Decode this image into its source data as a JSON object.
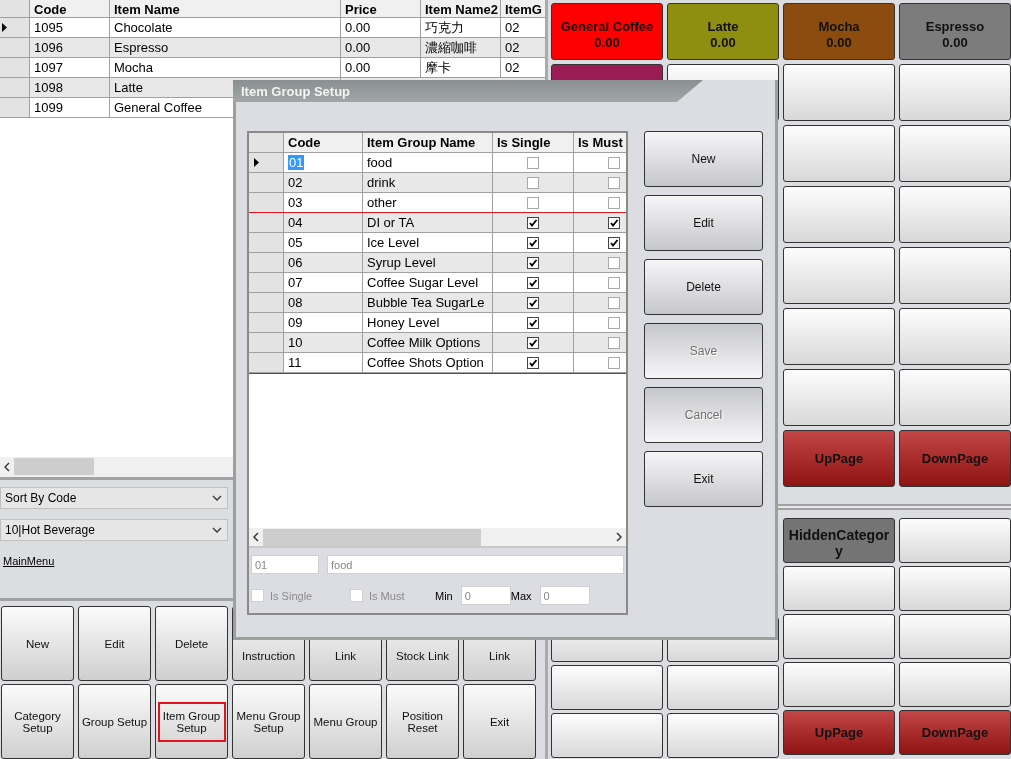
{
  "item_table": {
    "columns": [
      "Code",
      "Item Name",
      "Price",
      "Item Name2",
      "ItemG"
    ],
    "rows": [
      {
        "code": "1095",
        "name": "Chocolate",
        "price": "0.00",
        "name2": "巧克力",
        "group": "02",
        "selected": true
      },
      {
        "code": "1096",
        "name": "Espresso",
        "price": "0.00",
        "name2": "濃縮咖啡",
        "group": "02",
        "selected": false
      },
      {
        "code": "1097",
        "name": "Mocha",
        "price": "0.00",
        "name2": "摩卡",
        "group": "02",
        "selected": false
      },
      {
        "code": "1098",
        "name": "Latte",
        "selected": false
      },
      {
        "code": "1099",
        "name": "General Coffee",
        "selected": false
      }
    ]
  },
  "sort_dropdown": {
    "value": "Sort By Code"
  },
  "category_dropdown": {
    "value": "10|Hot Beverage"
  },
  "main_menu_link": "MainMenu",
  "actions": [
    {
      "label": "New",
      "highlighted": false
    },
    {
      "label": "Edit",
      "highlighted": false
    },
    {
      "label": "Delete",
      "highlighted": false
    },
    {
      "label": "Instruction",
      "highlighted": false
    },
    {
      "label": "Link",
      "highlighted": false
    },
    {
      "label": "Stock Link",
      "highlighted": false
    },
    {
      "label": "Link",
      "highlighted": false
    },
    {
      "label": "Category Setup",
      "highlighted": false
    },
    {
      "label": "Group Setup",
      "highlighted": false
    },
    {
      "label": "Item Group Setup",
      "highlighted": true
    },
    {
      "label": "Menu Group Setup",
      "highlighted": false
    },
    {
      "label": "Menu Group",
      "highlighted": false
    },
    {
      "label": "Position Reset",
      "highlighted": false
    },
    {
      "label": "Exit",
      "highlighted": false
    }
  ],
  "tiles": {
    "upper_left": [
      {
        "kind": "item",
        "name": "General Coffee",
        "price": "0.00",
        "color": "#ff0000"
      },
      {
        "kind": "item",
        "name": "Latte",
        "price": "0.00",
        "color": "#8e8e10"
      },
      {
        "kind": "swatch",
        "color": "#9b1b54"
      },
      {
        "kind": "blank"
      }
    ],
    "upper_right": [
      {
        "kind": "item",
        "name": "Mocha",
        "price": "0.00",
        "color": "#8c4c10"
      },
      {
        "kind": "item",
        "name": "Espresso",
        "price": "0.00",
        "color": "#7c7c7c"
      },
      {
        "kind": "blank"
      },
      {
        "kind": "blank"
      },
      {
        "kind": "blank"
      },
      {
        "kind": "blank"
      },
      {
        "kind": "blank"
      },
      {
        "kind": "blank"
      },
      {
        "kind": "blank"
      },
      {
        "kind": "blank"
      },
      {
        "kind": "blank"
      },
      {
        "kind": "blank"
      },
      {
        "kind": "blank"
      },
      {
        "kind": "blank"
      },
      {
        "kind": "nav",
        "label": "UpPage"
      },
      {
        "kind": "nav",
        "label": "DownPage"
      }
    ],
    "lower_left": [
      {
        "kind": "blank"
      },
      {
        "kind": "blank"
      },
      {
        "kind": "blank"
      },
      {
        "kind": "blank"
      },
      {
        "kind": "blank"
      },
      {
        "kind": "blank"
      }
    ],
    "lower_right": [
      {
        "kind": "item",
        "name": "HiddenCategory",
        "color": "#747474"
      },
      {
        "kind": "blank"
      },
      {
        "kind": "blank"
      },
      {
        "kind": "blank"
      },
      {
        "kind": "blank"
      },
      {
        "kind": "blank"
      },
      {
        "kind": "blank"
      },
      {
        "kind": "blank"
      },
      {
        "kind": "nav",
        "label": "UpPage"
      },
      {
        "kind": "nav",
        "label": "DownPage"
      }
    ]
  },
  "dialog": {
    "title": "Item Group Setup",
    "columns": [
      "Code",
      "Item Group Name",
      "Is Single",
      "Is Must"
    ],
    "row_groups": [
      {
        "highlighted": false,
        "rows": [
          {
            "code": "01",
            "name": "food",
            "is_single": false,
            "is_must": false,
            "selected": true
          },
          {
            "code": "02",
            "name": "drink",
            "is_single": false,
            "is_must": false,
            "selected": false
          },
          {
            "code": "03",
            "name": "other",
            "is_single": false,
            "is_must": false,
            "selected": false
          }
        ]
      },
      {
        "highlighted": true,
        "rows": [
          {
            "code": "04",
            "name": "DI or TA",
            "is_single": true,
            "is_must": true,
            "selected": false
          },
          {
            "code": "05",
            "name": "Ice Level",
            "is_single": true,
            "is_must": true,
            "selected": false
          },
          {
            "code": "06",
            "name": "Syrup Level",
            "is_single": true,
            "is_must": false,
            "selected": false
          },
          {
            "code": "07",
            "name": "Coffee Sugar Level",
            "is_single": true,
            "is_must": false,
            "selected": false
          },
          {
            "code": "08",
            "name": "Bubble Tea SugarLe",
            "is_single": true,
            "is_must": false,
            "selected": false
          },
          {
            "code": "09",
            "name": "Honey Level",
            "is_single": true,
            "is_must": false,
            "selected": false
          },
          {
            "code": "10",
            "name": "Coffee Milk Options",
            "is_single": true,
            "is_must": false,
            "selected": false
          },
          {
            "code": "11",
            "name": "Coffee Shots Option",
            "is_single": true,
            "is_must": false,
            "selected": false
          }
        ]
      }
    ],
    "buttons": [
      {
        "label": "New",
        "disabled": false
      },
      {
        "label": "Edit",
        "disabled": false
      },
      {
        "label": "Delete",
        "disabled": false
      },
      {
        "label": "Save",
        "disabled": true
      },
      {
        "label": "Cancel",
        "disabled": true
      },
      {
        "label": "Exit",
        "disabled": false
      }
    ],
    "form": {
      "code": "01",
      "name": "food",
      "is_single_label": "Is Single",
      "is_single": false,
      "is_must_label": "Is Must",
      "is_must": false,
      "min_label": "Min",
      "min": "0",
      "max_label": "Max",
      "max": "0"
    }
  }
}
